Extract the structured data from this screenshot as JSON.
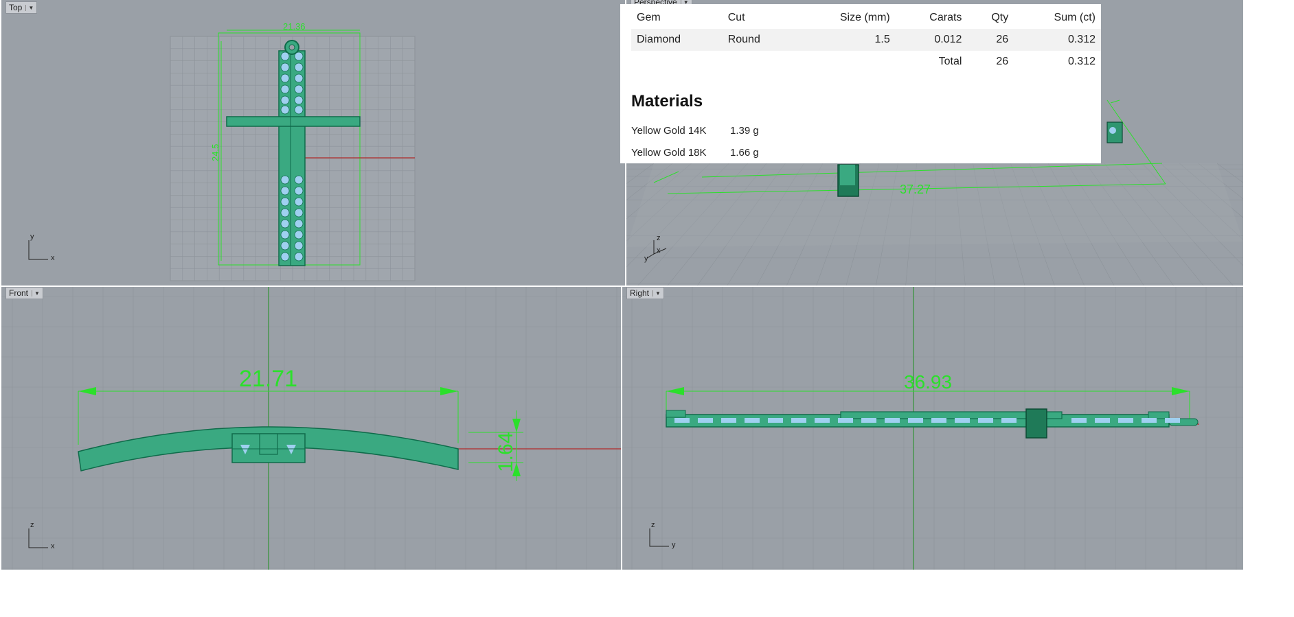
{
  "viewports": {
    "top": {
      "label": "Top",
      "dims": {
        "width": "21.36",
        "height": "24.5"
      },
      "axes": {
        "h": "x",
        "v": "y"
      }
    },
    "perspective": {
      "label": "Perspective",
      "dims": {
        "length": "37.27"
      },
      "axes": {
        "h": "x",
        "v": "z",
        "d": "y"
      }
    },
    "front": {
      "label": "Front",
      "dims": {
        "width": "21.71",
        "height": "1.64"
      },
      "axes": {
        "h": "x",
        "v": "z"
      }
    },
    "right": {
      "label": "Right",
      "dims": {
        "length": "36.93"
      },
      "axes": {
        "h": "y",
        "v": "z"
      }
    }
  },
  "report": {
    "columns": [
      "Gem",
      "Cut",
      "Size (mm)",
      "Carats",
      "Qty",
      "Sum (ct)"
    ],
    "rows": [
      {
        "gem": "Diamond",
        "cut": "Round",
        "size": "1.5",
        "carats": "0.012",
        "qty": "26",
        "sum": "0.312"
      }
    ],
    "total": {
      "label": "Total",
      "qty": "26",
      "sum": "0.312"
    },
    "materials_title": "Materials",
    "materials": [
      {
        "name": "Yellow Gold 14K",
        "weight": "1.39 g"
      },
      {
        "name": "Yellow Gold 18K",
        "weight": "1.66 g"
      }
    ]
  },
  "colors": {
    "viewport_bg": "#9aa0a7",
    "dimension": "#2be02b",
    "model_fill": "#3aa981",
    "model_edge": "#0f6b4a",
    "gem": "#9fd0f0",
    "axis_x": "#b02a2a",
    "axis_z": "#1f8f1f"
  }
}
